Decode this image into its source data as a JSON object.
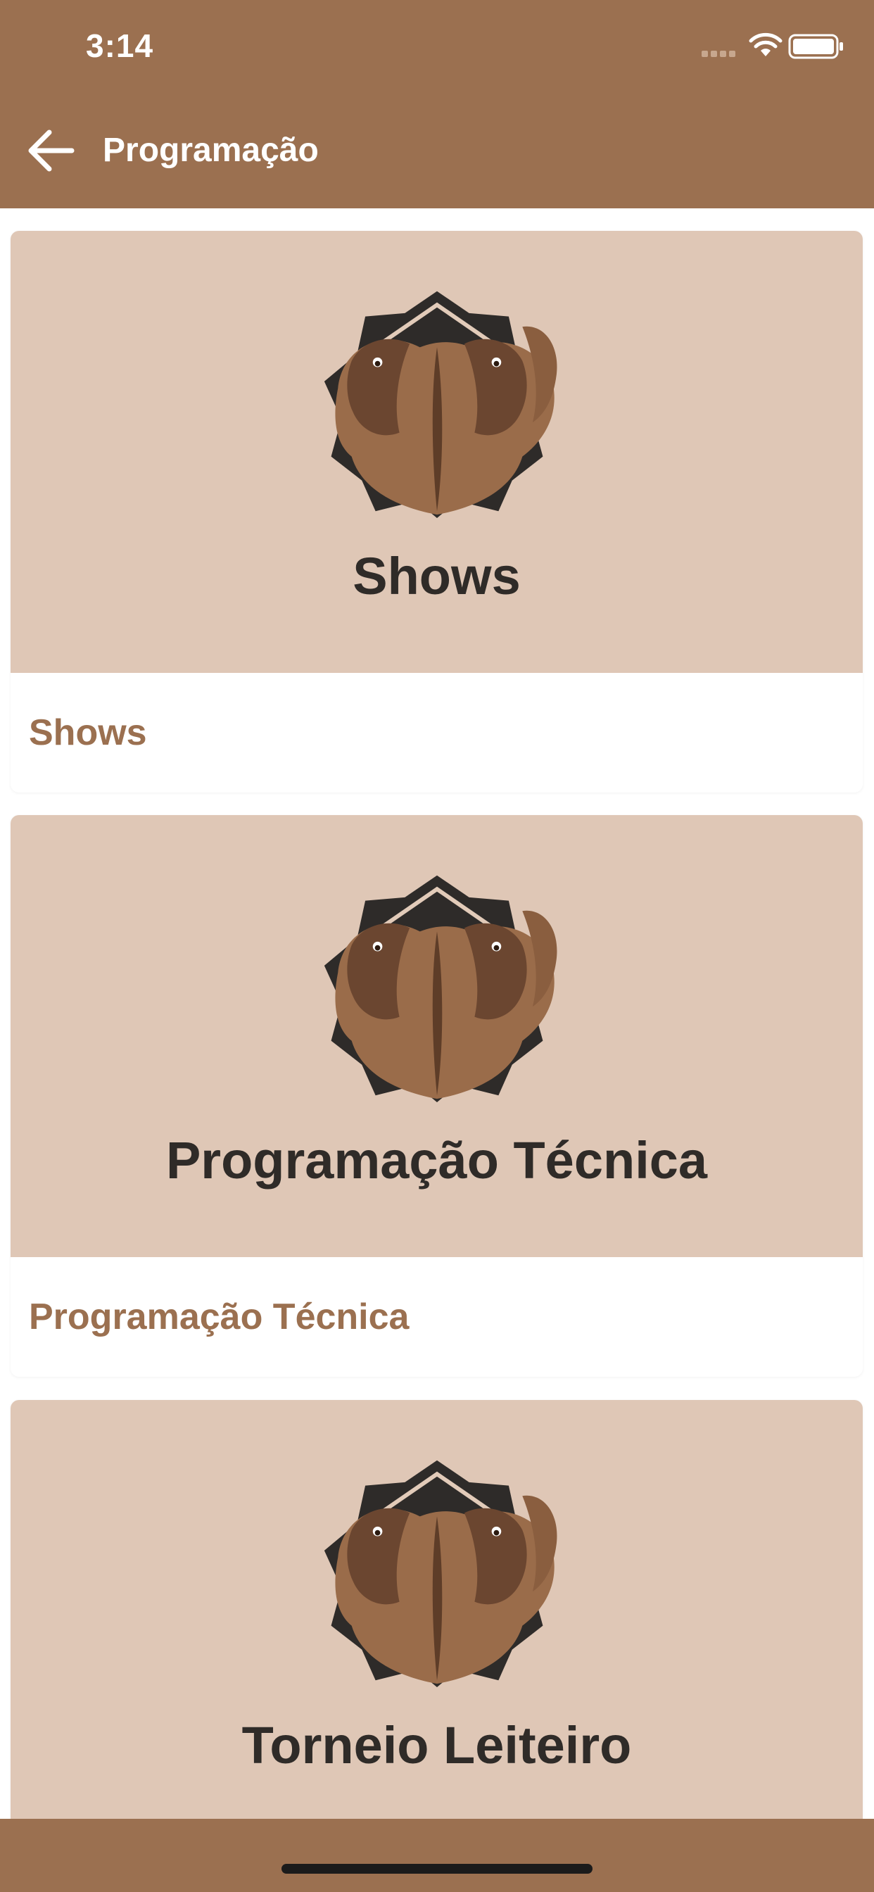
{
  "status_bar": {
    "time": "3:14"
  },
  "header": {
    "title": "Programação"
  },
  "cards": [
    {
      "image_title": "Shows",
      "label": "Shows"
    },
    {
      "image_title": "Programação Técnica",
      "label": "Programação Técnica"
    },
    {
      "image_title": "Torneio Leiteiro",
      "label": ""
    }
  ],
  "icons": {
    "back": "arrow-left-icon",
    "wifi": "wifi-icon",
    "battery": "battery-icon",
    "signal": "signal-dots-icon",
    "logo": "twin-cattle-logo"
  },
  "colors": {
    "primary": "#9b7050",
    "card_image_bg": "#dfc7b6",
    "title_dark": "#2f2b28"
  }
}
